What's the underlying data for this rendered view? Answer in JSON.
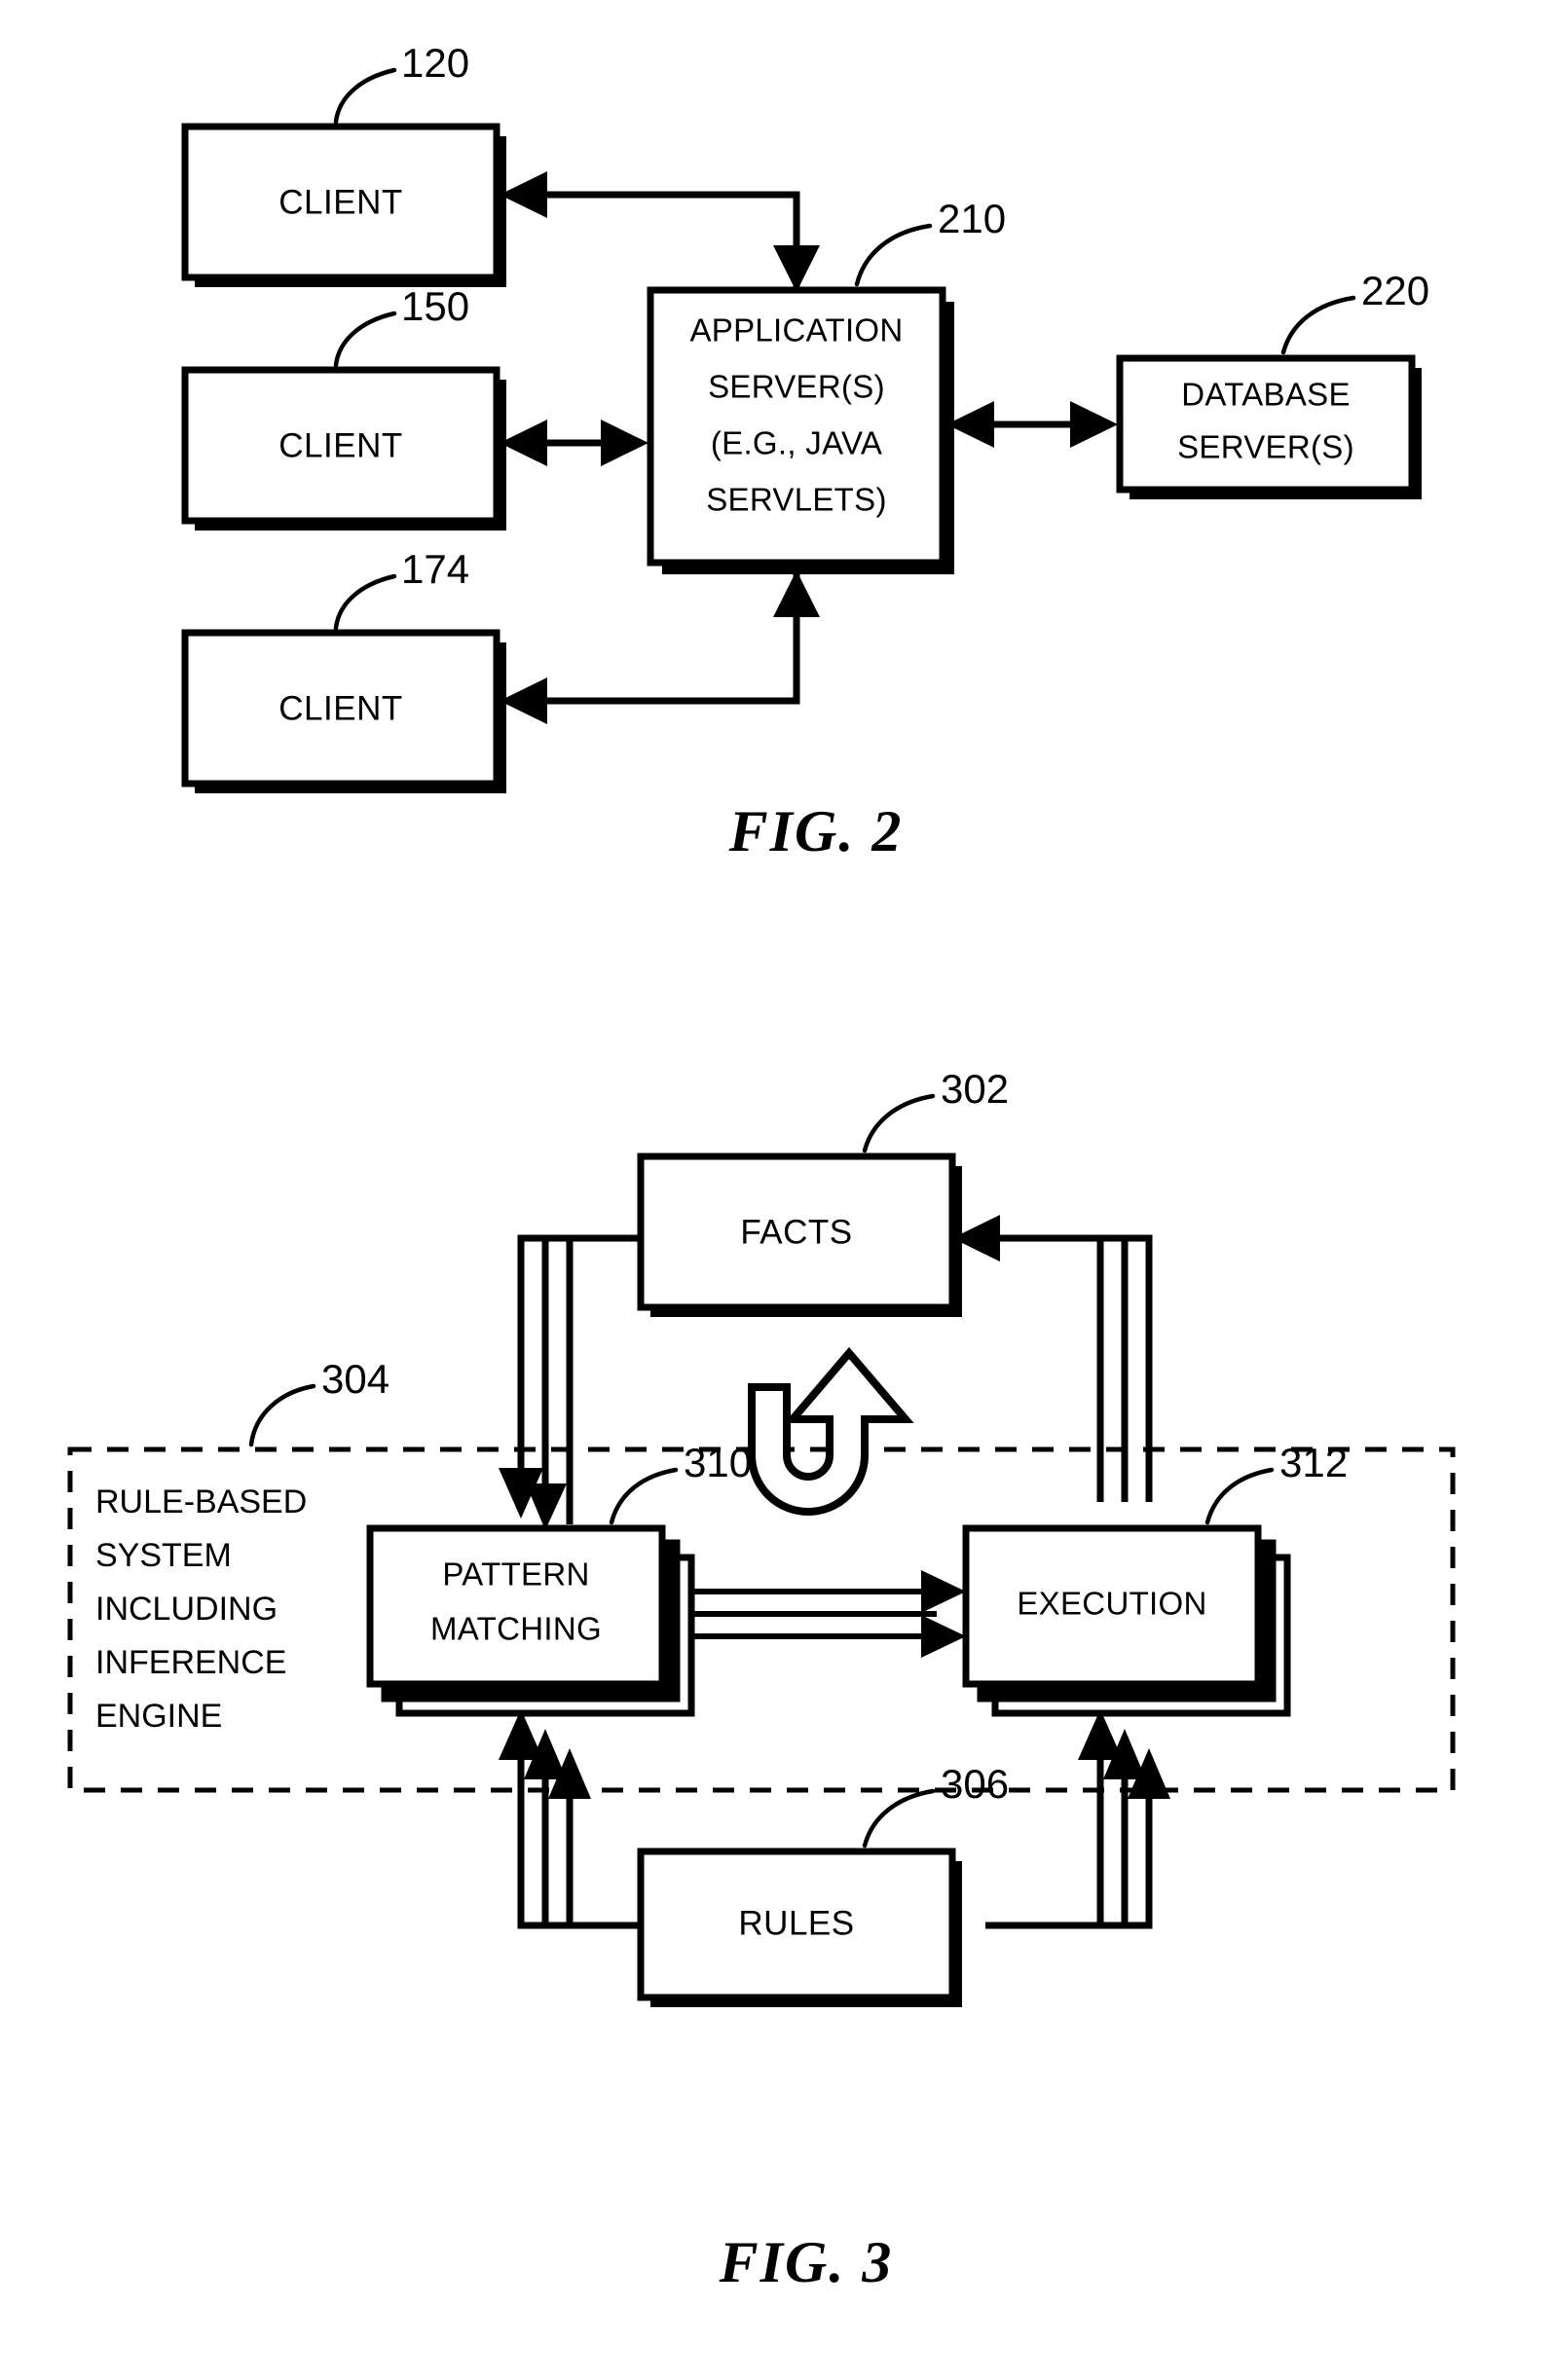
{
  "document": {
    "type": "patent-drawing-sheet",
    "figures": [
      {
        "id": "fig2",
        "caption": "FIG. 2",
        "nodes": [
          {
            "key": "client_120",
            "label": "CLIENT",
            "ref": "120"
          },
          {
            "key": "client_150",
            "label": "CLIENT",
            "ref": "150"
          },
          {
            "key": "client_174",
            "label": "CLIENT",
            "ref": "174"
          },
          {
            "key": "app_server",
            "ref": "210",
            "lines": [
              "APPLICATION",
              "SERVER(S)",
              "(E.G., JAVA",
              "SERVLETS)"
            ]
          },
          {
            "key": "db_server",
            "ref": "220",
            "lines": [
              "DATABASE",
              "SERVER(S)"
            ]
          }
        ],
        "edges": [
          {
            "from": "app_server",
            "to": "client_120",
            "direction": "one-way"
          },
          {
            "from": "client_150",
            "to": "app_server",
            "direction": "two-way"
          },
          {
            "from": "app_server",
            "to": "client_174",
            "direction": "one-way"
          },
          {
            "from": "app_server",
            "to": "db_server",
            "direction": "two-way"
          }
        ]
      },
      {
        "id": "fig3",
        "caption": "FIG. 3",
        "nodes": [
          {
            "key": "facts",
            "label": "FACTS",
            "ref": "302"
          },
          {
            "key": "rules",
            "label": "RULES",
            "ref": "306"
          },
          {
            "key": "pattern_matching",
            "ref": "310",
            "lines": [
              "PATTERN",
              "MATCHING"
            ],
            "stacked": true
          },
          {
            "key": "execution",
            "ref": "312",
            "lines": [
              "EXECUTION"
            ],
            "stacked": true
          }
        ],
        "group": {
          "key": "rule_based_system",
          "ref": "304",
          "style": "dashed",
          "lines": [
            "RULE-BASED",
            "SYSTEM",
            "INCLUDING",
            "INFERENCE",
            "ENGINE"
          ]
        },
        "edges": [
          {
            "from": "facts",
            "to": "pattern_matching",
            "direction": "one-way",
            "multiplicity": 3
          },
          {
            "from": "pattern_matching",
            "to": "execution",
            "direction": "one-way",
            "multiplicity": 3
          },
          {
            "from": "execution",
            "to": "facts",
            "direction": "one-way",
            "multiplicity": 3
          },
          {
            "from": "rules",
            "to": "pattern_matching",
            "direction": "one-way",
            "multiplicity": 3
          },
          {
            "from": "rules",
            "to": "execution",
            "direction": "one-way",
            "multiplicity": 3
          }
        ],
        "annotations": [
          {
            "key": "cycle_arrow",
            "shape": "u-turn-rotation-arrow"
          }
        ]
      }
    ],
    "colors": {
      "ink": "#000000",
      "paper": "#ffffff"
    }
  }
}
